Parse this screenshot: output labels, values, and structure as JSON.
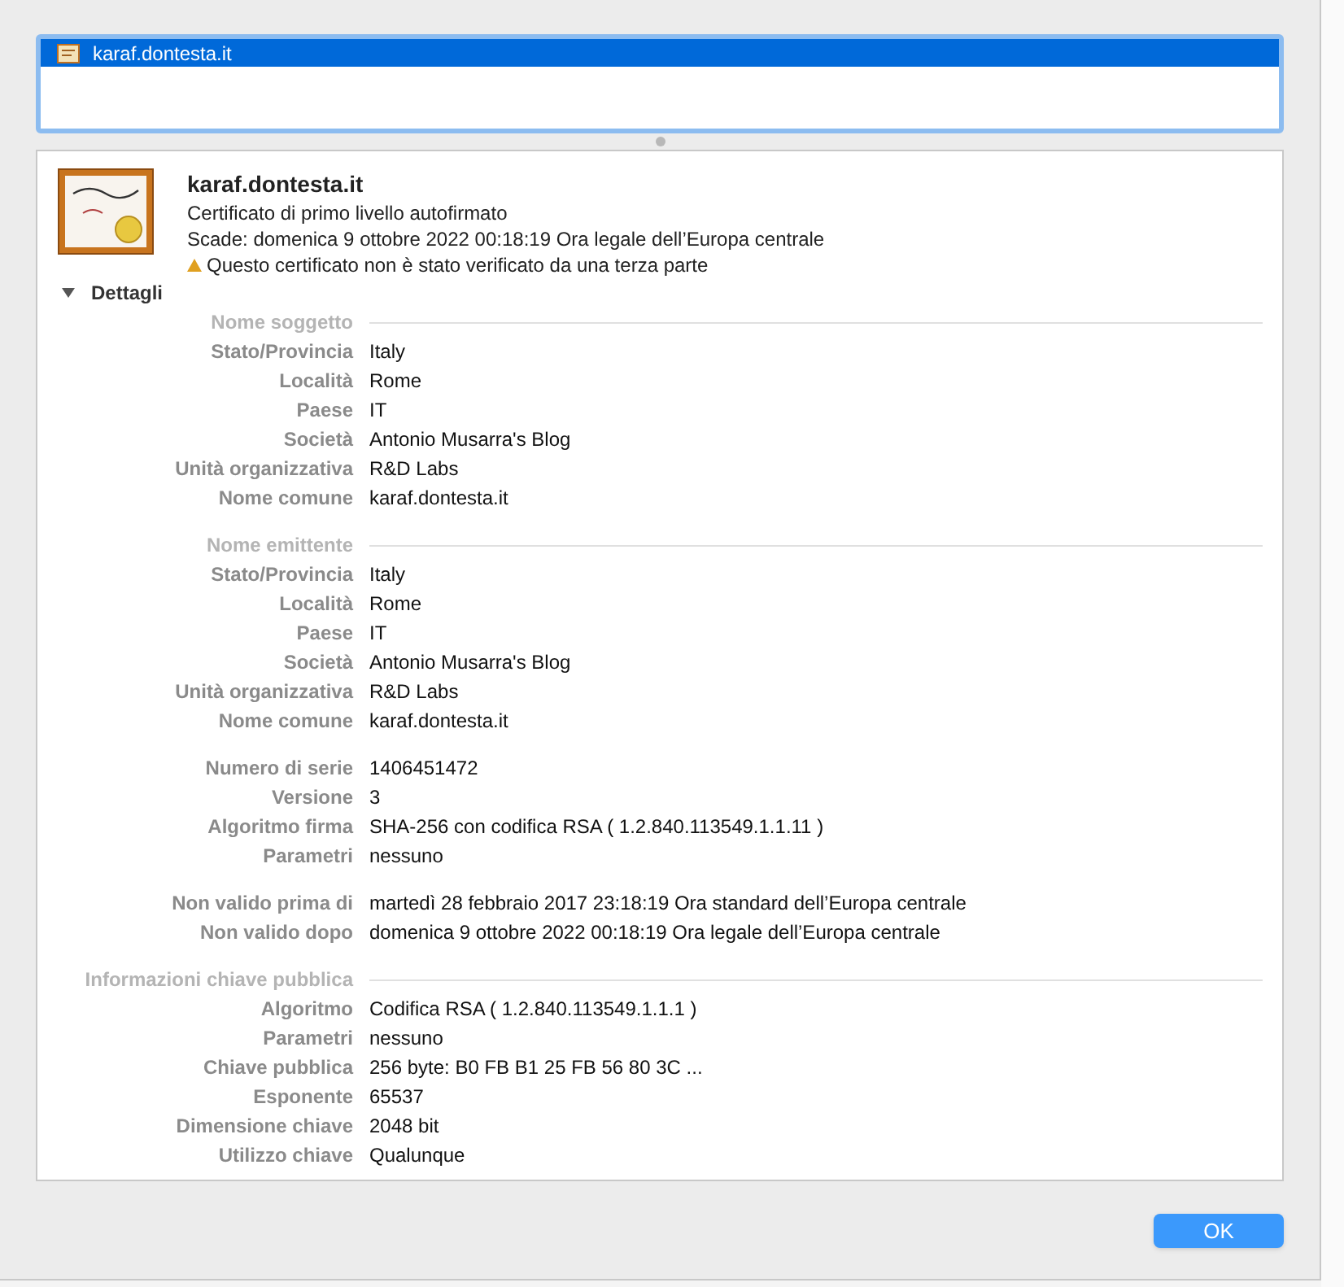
{
  "list": {
    "items": [
      {
        "label": "karaf.dontesta.it",
        "selected": true
      }
    ]
  },
  "certificate": {
    "name": "karaf.dontesta.it",
    "type_line": "Certificato di primo livello autofirmato",
    "expires": "Scade: domenica 9 ottobre 2022 00:18:19 Ora legale dell’Europa centrale",
    "warning": "Questo certificato non è stato verificato da una terza parte"
  },
  "details": {
    "label": "Dettagli",
    "expanded": true,
    "sections": [
      {
        "title": "Nome soggetto",
        "rows": [
          {
            "label": "Stato/Provincia",
            "value": "Italy"
          },
          {
            "label": "Località",
            "value": "Rome"
          },
          {
            "label": "Paese",
            "value": "IT"
          },
          {
            "label": "Società",
            "value": "Antonio Musarra's Blog"
          },
          {
            "label": "Unità organizzativa",
            "value": "R&D Labs"
          },
          {
            "label": "Nome comune",
            "value": "karaf.dontesta.it"
          }
        ]
      },
      {
        "title": "Nome emittente",
        "rows": [
          {
            "label": "Stato/Provincia",
            "value": "Italy"
          },
          {
            "label": "Località",
            "value": "Rome"
          },
          {
            "label": "Paese",
            "value": "IT"
          },
          {
            "label": "Società",
            "value": "Antonio Musarra's Blog"
          },
          {
            "label": "Unità organizzativa",
            "value": "R&D Labs"
          },
          {
            "label": "Nome comune",
            "value": "karaf.dontesta.it"
          }
        ]
      },
      {
        "rows": [
          {
            "label": "Numero di serie",
            "value": "1406451472"
          },
          {
            "label": "Versione",
            "value": "3"
          },
          {
            "label": "Algoritmo firma",
            "value": "SHA-256 con codifica RSA ( 1.2.840.113549.1.1.11 )"
          },
          {
            "label": "Parametri",
            "value": "nessuno"
          }
        ]
      },
      {
        "rows": [
          {
            "label": "Non valido prima di",
            "value": "martedì 28 febbraio 2017 23:18:19 Ora standard dell’Europa centrale"
          },
          {
            "label": "Non valido dopo",
            "value": "domenica 9 ottobre 2022 00:18:19 Ora legale dell’Europa centrale"
          }
        ]
      },
      {
        "title": "Informazioni chiave pubblica",
        "rows": [
          {
            "label": "Algoritmo",
            "value": "Codifica RSA ( 1.2.840.113549.1.1.1 )"
          },
          {
            "label": "Parametri",
            "value": "nessuno"
          },
          {
            "label": "Chiave pubblica",
            "value": "256 byte: B0 FB B1 25 FB 56 80 3C ..."
          },
          {
            "label": "Esponente",
            "value": "65537"
          },
          {
            "label": "Dimensione chiave",
            "value": "2048 bit"
          },
          {
            "label": "Utilizzo chiave",
            "value": "Qualunque"
          }
        ]
      }
    ]
  },
  "buttons": [
    {
      "label": "OK"
    }
  ]
}
